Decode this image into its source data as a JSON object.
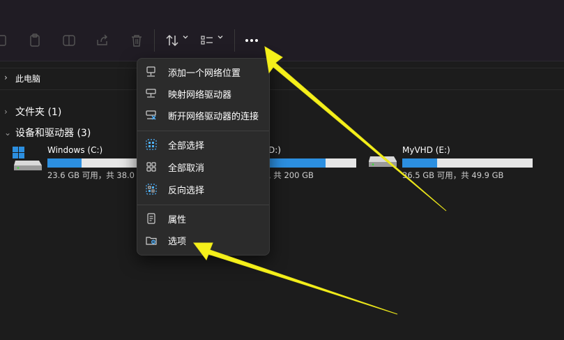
{
  "address": {
    "breadcrumb": "此电脑"
  },
  "toolbar": {
    "icons": [
      "copy-icon",
      "paste-icon",
      "rename-icon",
      "share-icon",
      "delete-icon",
      "sort-icon",
      "view-icon",
      "more-icon"
    ]
  },
  "groups": {
    "folders": "文件夹 (1)",
    "drives": "设备和驱动器 (3)"
  },
  "drives": [
    {
      "name": "Windows (C:)",
      "capacity": "23.6 GB 可用，共 38.0",
      "used_fraction": 0.38
    },
    {
      "name": "D:)",
      "capacity": ", 共 200 GB",
      "used_fraction": 0.65
    },
    {
      "name": "MyVHD (E:)",
      "capacity": "36.5 GB 可用，共 49.9 GB",
      "used_fraction": 0.27
    }
  ],
  "menu": {
    "items": [
      {
        "label": "添加一个网络位置",
        "icon": "network-location-icon"
      },
      {
        "label": "映射网络驱动器",
        "icon": "map-drive-icon"
      },
      {
        "label": "断开网络驱动器的连接",
        "icon": "disconnect-drive-icon"
      },
      {
        "label": "全部选择",
        "icon": "select-all-icon"
      },
      {
        "label": "全部取消",
        "icon": "select-none-icon"
      },
      {
        "label": "反向选择",
        "icon": "invert-selection-icon"
      },
      {
        "label": "属性",
        "icon": "properties-icon"
      },
      {
        "label": "选项",
        "icon": "options-icon"
      }
    ]
  },
  "colors": {
    "accent": "#2c8fe0",
    "arrow": "#f5f01a",
    "menu_bg": "#2b2b2b",
    "toolbar_bg": "#201c24"
  }
}
